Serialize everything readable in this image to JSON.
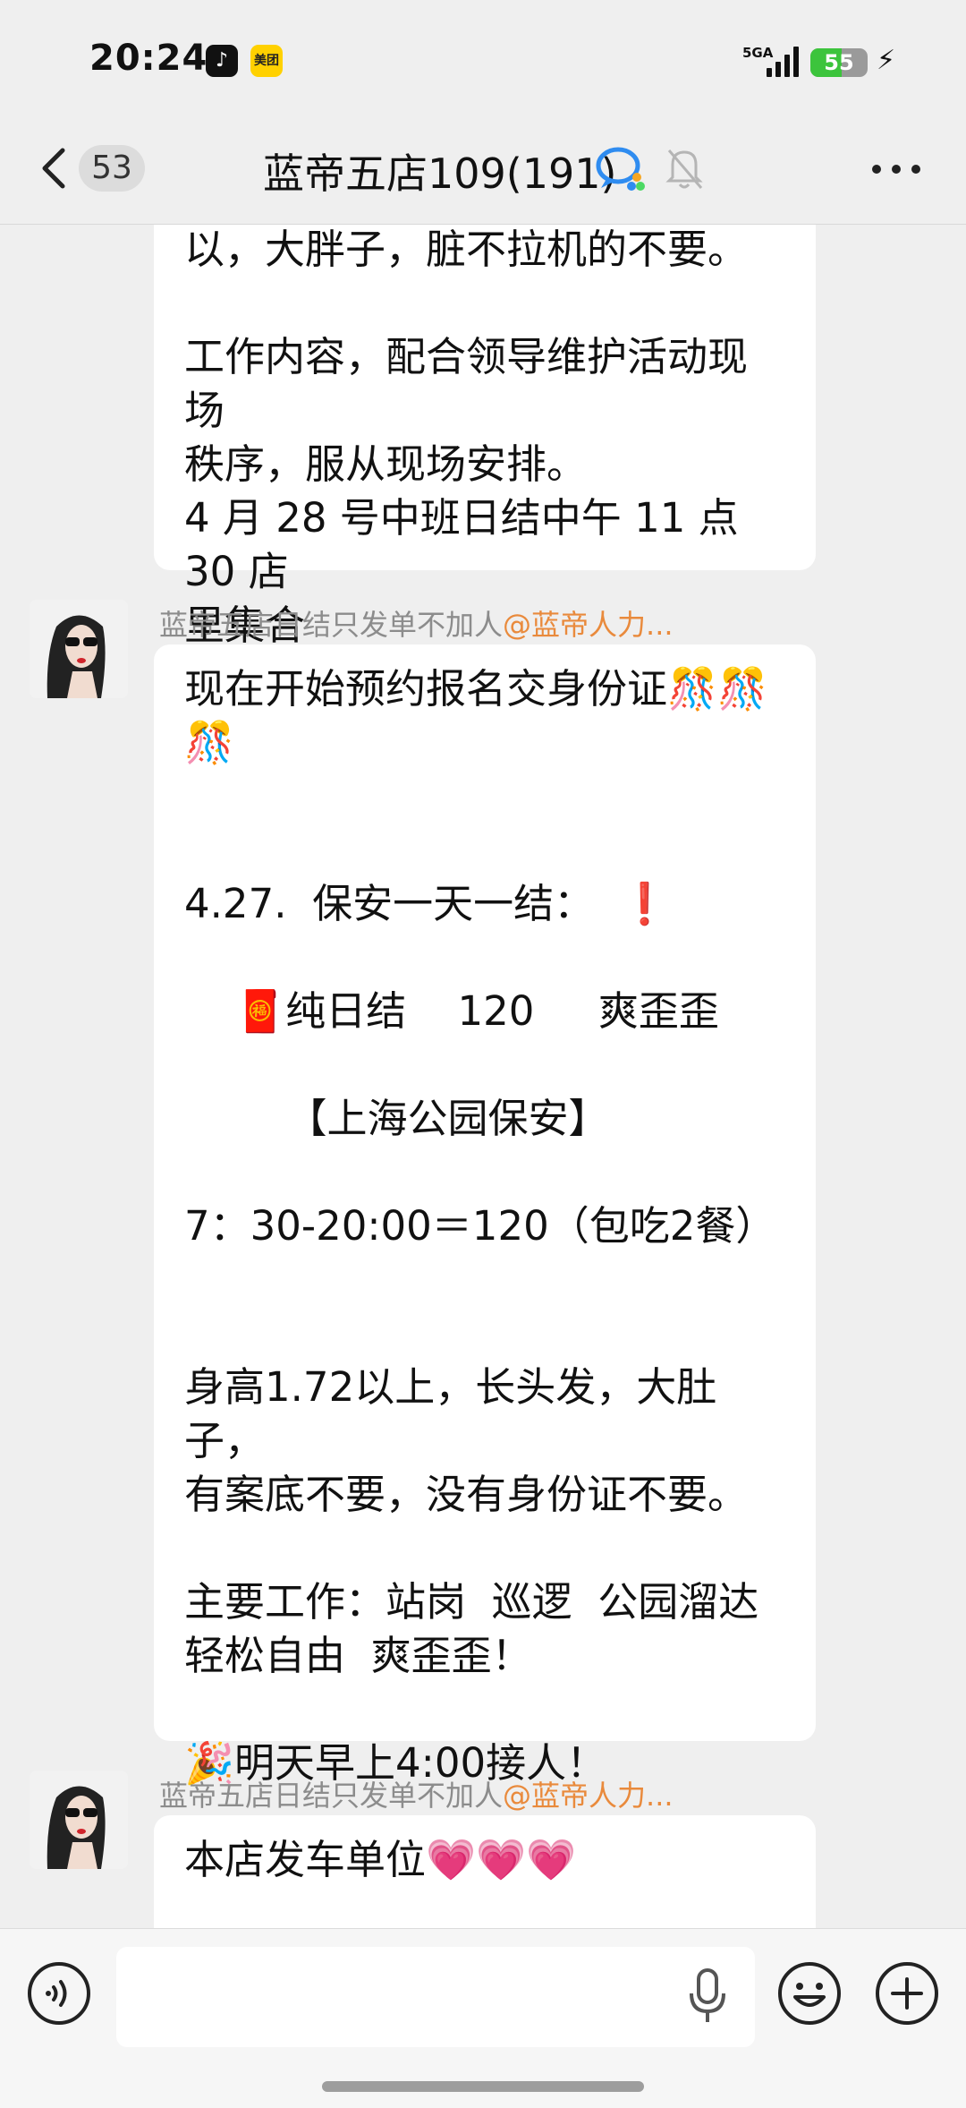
{
  "status_bar": {
    "time": "20:24",
    "app_icons": [
      "tiktok-icon",
      "meituan-icon"
    ],
    "meituan_label": "美团",
    "network": "5GA",
    "battery": "55",
    "battery_level": 0.55
  },
  "nav": {
    "unread_count": "53",
    "title": "蓝帝五店109(191)",
    "icons": [
      "back-icon",
      "group-icon",
      "mute-icon",
      "more-icon"
    ]
  },
  "messages": [
    {
      "lines": [
        "以，大胖子，脏不拉机的不要。",
        "",
        "工作内容，配合领导维护活动现场",
        "秩序，服从现场安排。",
        "4 月 28 号中班日结中午 11 点 30 店",
        "里集合"
      ]
    },
    {
      "sender": "蓝帝五店日结只发单不加人",
      "mention": "@蓝帝人力...",
      "lines": [
        "现在开始预约报名交身份证🎊🎊",
        "🎊",
        "",
        "",
        "4.27.  保安一天一结：  ❗",
        "",
        "    🧧纯日结    120     爽歪歪",
        "",
        "        【上海公园保安】",
        "",
        "7：30-20:00＝120（包吃2餐）",
        "",
        "",
        "身高1.72以上，长头发，大肚子，",
        "有案底不要，没有身份证不要。",
        "",
        "主要工作：站岗  巡逻  公园溜达",
        "轻松自由  爽歪歪！",
        "",
        "🎉明天早上4:00接人！"
      ]
    },
    {
      "sender": "蓝帝五店日结只发单不加人",
      "mention": "@蓝帝人力...",
      "lines": [
        "本店发车单位💗💗💗"
      ]
    }
  ],
  "input_bar": {
    "placeholder": "",
    "icons": [
      "voice-icon",
      "mic-icon",
      "emoji-icon",
      "plus-icon"
    ]
  }
}
